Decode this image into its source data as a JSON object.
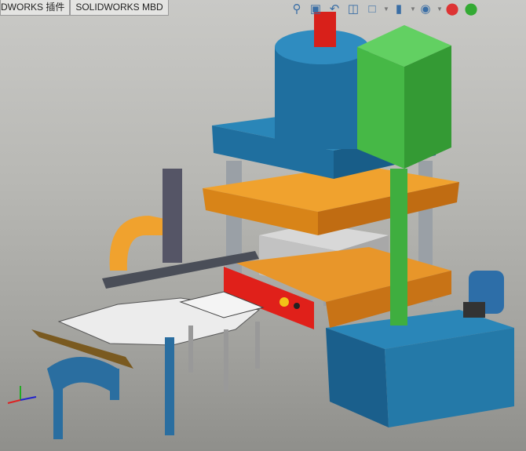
{
  "tabs": [
    {
      "label": "DWORKS 插件"
    },
    {
      "label": "SOLIDWORKS MBD"
    }
  ],
  "view_toolbar": [
    "zoom-to-fit-icon",
    "zoom-area-icon",
    "previous-view-icon",
    "section-view-icon",
    "view-orientation-icon",
    "display-style-icon",
    "hide-show-items-icon",
    "edit-appearance-icon",
    "apply-scene-icon"
  ],
  "colors": {
    "press_blue": "#1f6f9f",
    "green_box": "#4ec24e",
    "orange_plate": "#e28a1e",
    "red_panel": "#e0201a",
    "viewport_bg": "#b8b8b4"
  }
}
